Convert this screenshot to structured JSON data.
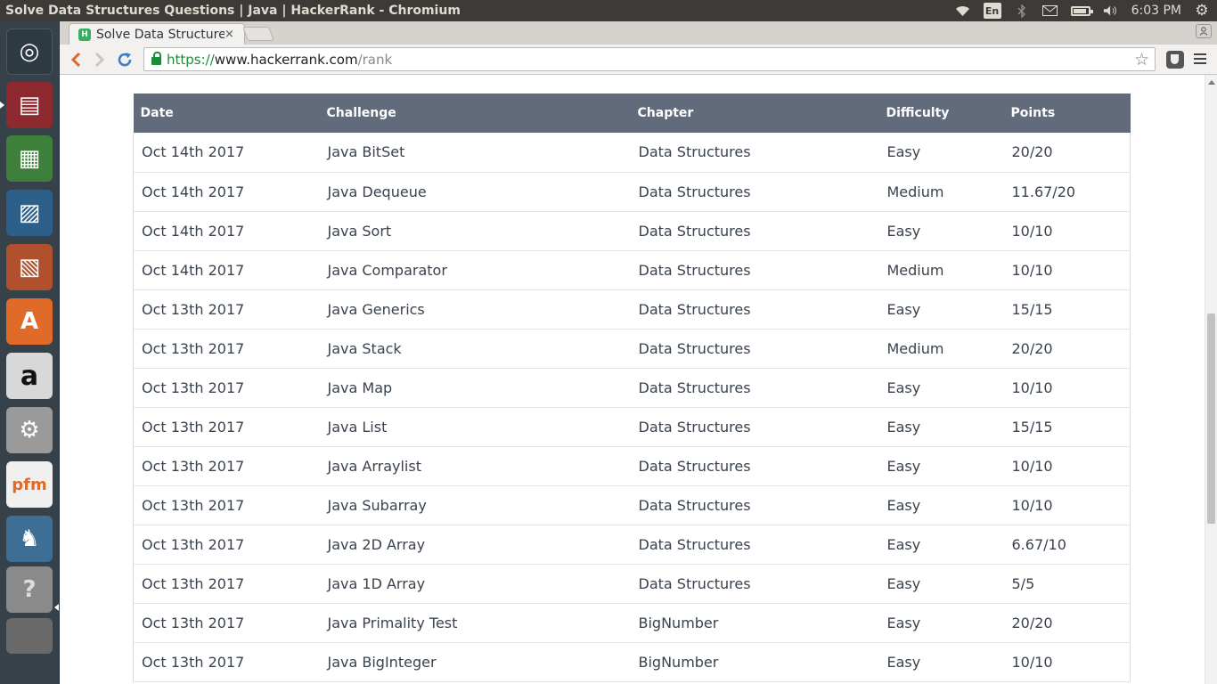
{
  "window": {
    "title": "Solve Data Structures Questions | Java | HackerRank - Chromium"
  },
  "system_tray": {
    "language": "En",
    "clock": "6:03 PM"
  },
  "browser": {
    "tab_title": "Solve Data Structures Questions | Java | HackerRank",
    "tab_close": "×",
    "favicon_letter": "H",
    "url": {
      "scheme": "https://",
      "host": "www.hackerrank.com",
      "path": "/rank"
    }
  },
  "table": {
    "headers": {
      "date": "Date",
      "challenge": "Challenge",
      "chapter": "Chapter",
      "difficulty": "Difficulty",
      "points": "Points"
    },
    "rows": [
      {
        "date": "Oct 14th 2017",
        "challenge": "Java BitSet",
        "chapter": "Data Structures",
        "difficulty": "Easy",
        "points": "20/20"
      },
      {
        "date": "Oct 14th 2017",
        "challenge": "Java Dequeue",
        "chapter": "Data Structures",
        "difficulty": "Medium",
        "points": "11.67/20"
      },
      {
        "date": "Oct 14th 2017",
        "challenge": "Java Sort",
        "chapter": "Data Structures",
        "difficulty": "Easy",
        "points": "10/10"
      },
      {
        "date": "Oct 14th 2017",
        "challenge": "Java Comparator",
        "chapter": "Data Structures",
        "difficulty": "Medium",
        "points": "10/10"
      },
      {
        "date": "Oct 13th 2017",
        "challenge": "Java Generics",
        "chapter": "Data Structures",
        "difficulty": "Easy",
        "points": "15/15"
      },
      {
        "date": "Oct 13th 2017",
        "challenge": "Java Stack",
        "chapter": "Data Structures",
        "difficulty": "Medium",
        "points": "20/20"
      },
      {
        "date": "Oct 13th 2017",
        "challenge": "Java Map",
        "chapter": "Data Structures",
        "difficulty": "Easy",
        "points": "10/10"
      },
      {
        "date": "Oct 13th 2017",
        "challenge": "Java List",
        "chapter": "Data Structures",
        "difficulty": "Easy",
        "points": "15/15"
      },
      {
        "date": "Oct 13th 2017",
        "challenge": "Java Arraylist",
        "chapter": "Data Structures",
        "difficulty": "Easy",
        "points": "10/10"
      },
      {
        "date": "Oct 13th 2017",
        "challenge": "Java Subarray",
        "chapter": "Data Structures",
        "difficulty": "Easy",
        "points": "10/10"
      },
      {
        "date": "Oct 13th 2017",
        "challenge": "Java 2D Array",
        "chapter": "Data Structures",
        "difficulty": "Easy",
        "points": "6.67/10"
      },
      {
        "date": "Oct 13th 2017",
        "challenge": "Java 1D Array",
        "chapter": "Data Structures",
        "difficulty": "Easy",
        "points": "5/5"
      },
      {
        "date": "Oct 13th 2017",
        "challenge": "Java Primality Test",
        "chapter": "BigNumber",
        "difficulty": "Easy",
        "points": "20/20"
      },
      {
        "date": "Oct 13th 2017",
        "challenge": "Java BigInteger",
        "chapter": "BigNumber",
        "difficulty": "Easy",
        "points": "10/10"
      }
    ]
  },
  "launcher": {
    "items": [
      {
        "name": "ubuntu-dash-icon",
        "glyph": "◎"
      },
      {
        "name": "files-icon",
        "glyph": "▤"
      },
      {
        "name": "libreoffice-calc-icon",
        "glyph": "▦"
      },
      {
        "name": "libreoffice-draw-icon",
        "glyph": "▨"
      },
      {
        "name": "libreoffice-impress-icon",
        "glyph": "▧"
      },
      {
        "name": "software-center-icon",
        "glyph": "A"
      },
      {
        "name": "amazon-icon",
        "glyph": "a"
      },
      {
        "name": "system-settings-icon",
        "glyph": "⚙"
      },
      {
        "name": "pfm-icon",
        "glyph": "pfm"
      },
      {
        "name": "pgadmin-icon",
        "glyph": "♞"
      },
      {
        "name": "help-icon",
        "glyph": "?"
      },
      {
        "name": "workspace-stack-icon",
        "glyph": ""
      }
    ]
  },
  "colors": {
    "table_header_bg": "#626b7c",
    "launcher_bg": "#36414a",
    "top_bar_bg": "#3c3b37",
    "secure_green": "#1e8a3a"
  }
}
